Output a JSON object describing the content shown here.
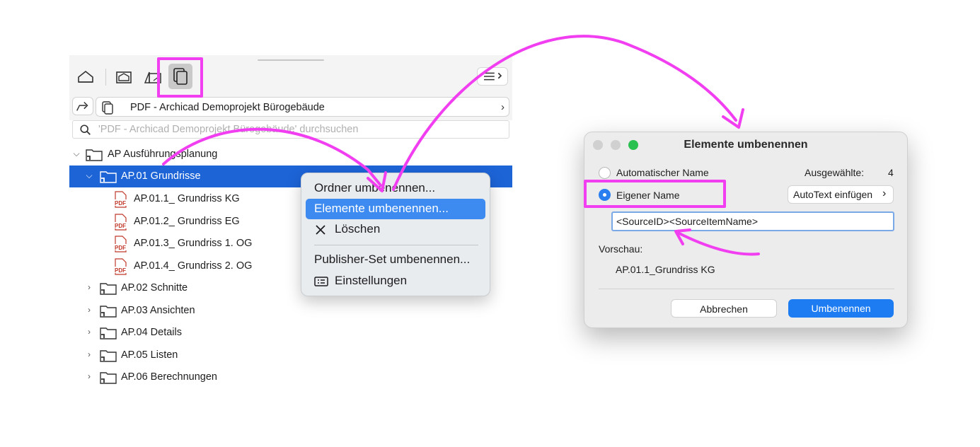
{
  "navigator": {
    "path_label": "PDF - Archicad Demoprojekt Bürogebäude",
    "path_chevron": "›",
    "search_placeholder": "'PDF - Archicad Demoprojekt Bürogebäude' durchsuchen",
    "toolbar_icons": [
      "project-map-icon",
      "view-map-icon",
      "layout-book-icon",
      "publisher-sets-icon",
      "menu-icon"
    ],
    "tree": {
      "root": {
        "label": "AP Ausführungsplanung",
        "expanded": true
      },
      "selected_folder": {
        "label": "AP.01 Grundrisse",
        "expanded": true
      },
      "items": [
        {
          "label": "AP.01.1_ Grundriss KG",
          "icon": "pdf-file-icon"
        },
        {
          "label": "AP.01.2_ Grundriss EG",
          "icon": "pdf-file-icon"
        },
        {
          "label": "AP.01.3_ Grundriss 1. OG",
          "icon": "pdf-file-icon"
        },
        {
          "label": "AP.01.4_ Grundriss 2. OG",
          "icon": "pdf-file-icon"
        }
      ],
      "folders": [
        {
          "label": "AP.02 Schnitte"
        },
        {
          "label": "AP.03 Ansichten"
        },
        {
          "label": "AP.04 Details"
        },
        {
          "label": "AP.05 Listen"
        },
        {
          "label": "AP.06 Berechnungen"
        }
      ]
    }
  },
  "context_menu": {
    "items": [
      {
        "label": "Ordner umbenennen..."
      },
      {
        "label": "Elemente umbenennen...",
        "highlighted": true
      },
      {
        "label": "Löschen",
        "icon": "close-x-icon"
      },
      {
        "label": "Publisher-Set umbenennen..."
      },
      {
        "label": "Einstellungen",
        "icon": "settings-card-icon"
      }
    ]
  },
  "dialog": {
    "title": "Elemente umbenennen",
    "radio_auto": "Automatischer Name",
    "radio_custom": "Eigener Name",
    "selected_label": "Ausgewählte:",
    "selected_count": "4",
    "autotext_button": "AutoText einfügen",
    "autotext_chevron": "›",
    "name_value": "<SourceID><SourceItemName>",
    "preview_label": "Vorschau:",
    "preview_value": "AP.01.1_Grundriss KG",
    "cancel_button": "Abbrechen",
    "ok_button": "Umbenennen"
  },
  "colors": {
    "selection": "#1d64d7",
    "menu_highlight": "#3d8af0",
    "primary_button": "#1d7cf2",
    "annotation": "#f03ef0",
    "traffic_lights": [
      "#d0d0d0",
      "#d0d0d0",
      "#2ac150"
    ]
  }
}
